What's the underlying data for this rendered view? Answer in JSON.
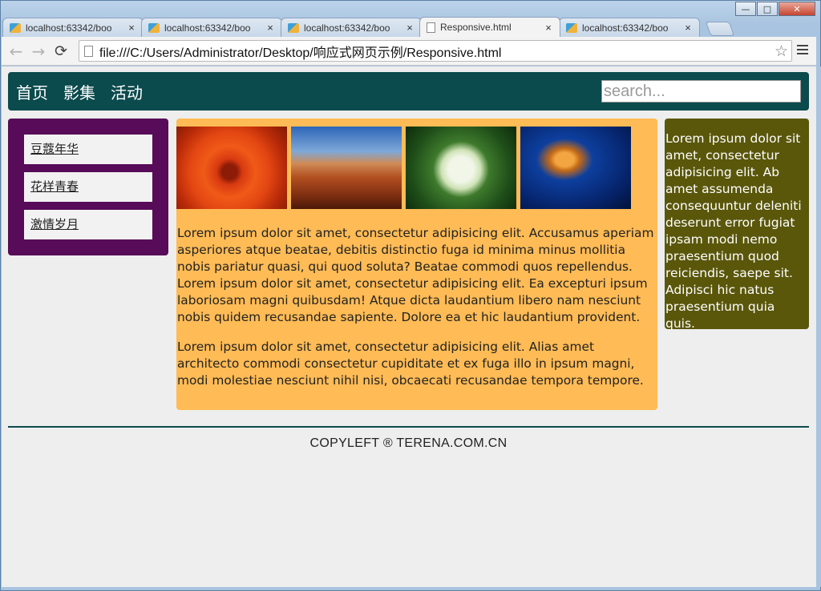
{
  "browser": {
    "tabs": [
      {
        "label": "localhost:63342/boo",
        "close": "×"
      },
      {
        "label": "localhost:63342/boo",
        "close": "×"
      },
      {
        "label": "localhost:63342/boo",
        "close": "×"
      },
      {
        "label": "Responsive.html",
        "close": "×"
      },
      {
        "label": "localhost:63342/boo",
        "close": "×"
      }
    ],
    "url": "file:///C:/Users/Administrator/Desktop/响应式网页示例/Responsive.html",
    "nav": {
      "back": "←",
      "forward": "→",
      "reload": "⟳",
      "star": "☆"
    },
    "window_controls": {
      "minimize": "—",
      "maximize": "□",
      "close": "✕"
    }
  },
  "page": {
    "nav": [
      "首页",
      "影集",
      "活动"
    ],
    "search_placeholder": "search...",
    "left_menu": [
      "豆蔻年华",
      "花样青春",
      "激情岁月"
    ],
    "images": [
      {
        "name": "chrysanthemum-image"
      },
      {
        "name": "desert-image"
      },
      {
        "name": "hydrangea-image"
      },
      {
        "name": "jellyfish-image"
      }
    ],
    "main_paragraphs": [
      "Lorem ipsum dolor sit amet, consectetur adipisicing elit. Accusamus aperiam asperiores atque beatae, debitis distinctio fuga id minima minus mollitia nobis pariatur quasi, qui quod soluta? Beatae commodi quos repellendus. Lorem ipsum dolor sit amet, consectetur adipisicing elit. Ea excepturi ipsum laboriosam magni quibusdam! Atque dicta laudantium libero nam nesciunt nobis quidem recusandae sapiente. Dolore ea et hic laudantium provident.",
      "Lorem ipsum dolor sit amet, consectetur adipisicing elit. Alias amet architecto commodi consectetur cupiditate et ex fuga illo in ipsum magni, modi molestiae nesciunt nihil nisi, obcaecati recusandae tempora tempore."
    ],
    "right_text": "Lorem ipsum dolor sit amet, consectetur adipisicing elit. Ab amet assumenda consequuntur deleniti deserunt error fugiat ipsam modi nemo praesentium quod reiciendis, saepe sit. Adipisci hic natus praesentium quia quis.",
    "footer": "COPYLEFT ® TERENA.COM.CN"
  },
  "colors": {
    "header_bg": "#0b4a4d",
    "left_panel_bg": "#570b58",
    "main_panel_bg": "#ffbb55",
    "right_panel_bg": "#5a570b",
    "page_bg": "#eeeeee"
  }
}
